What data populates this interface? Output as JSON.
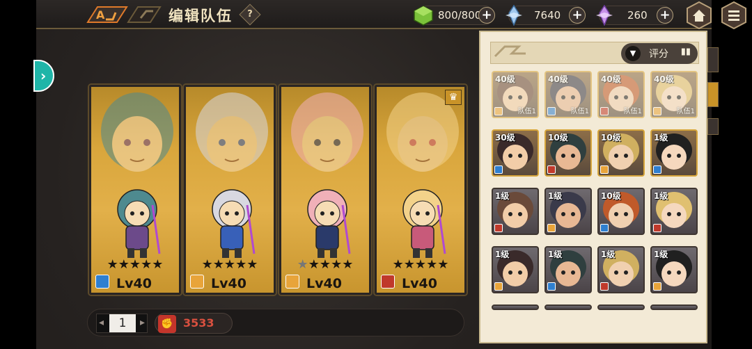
{
  "header": {
    "title": "编辑队伍",
    "help_label": "?"
  },
  "resources": [
    {
      "name": "stamina",
      "icon": "green-cube-icon",
      "value": "800/800",
      "color": "#7bc23a"
    },
    {
      "name": "crystal",
      "icon": "blue-crystal-icon",
      "value": "7640",
      "color": "#9fc7ee"
    },
    {
      "name": "gem",
      "icon": "purple-crystal-icon",
      "value": "260",
      "color": "#c690e8"
    }
  ],
  "team": {
    "page": "1",
    "power": "3533",
    "members": [
      {
        "name": "hero-1",
        "stars": 5,
        "level": "Lv40",
        "class_color": "#2f7fd0",
        "hair": "#4e8a8f",
        "accent": "#6c4a8a"
      },
      {
        "name": "hero-2",
        "stars": 5,
        "level": "Lv40",
        "class_color": "#e8a43a",
        "hair": "#d8d8e0",
        "accent": "#3860b8"
      },
      {
        "name": "hero-3",
        "stars": 4,
        "level": "Lv40",
        "class_color": "#e8a43a",
        "hair": "#f0b0b8",
        "accent": "#2a3a6a"
      },
      {
        "name": "hero-4",
        "stars": 5,
        "level": "Lv40",
        "class_color": "#c0392b",
        "hair": "#f3d28a",
        "accent": "#c85a7a",
        "crown": true
      }
    ]
  },
  "roster": {
    "sort_label": "评分",
    "heroes": [
      {
        "level": "40级",
        "team": "队伍1",
        "type": "gold",
        "dim": true
      },
      {
        "level": "40级",
        "team": "队伍1",
        "type": "gold",
        "dim": true
      },
      {
        "level": "40级",
        "team": "队伍1",
        "type": "gold",
        "dim": true
      },
      {
        "level": "40级",
        "team": "队伍1",
        "type": "gold",
        "dim": true
      },
      {
        "level": "30级",
        "team": "",
        "type": "gold"
      },
      {
        "level": "10级",
        "team": "",
        "type": "gold"
      },
      {
        "level": "10级",
        "team": "",
        "type": "gold"
      },
      {
        "level": "1级",
        "team": "",
        "type": "gold"
      },
      {
        "level": "1级",
        "team": "",
        "type": "purple"
      },
      {
        "level": "1级",
        "team": "",
        "type": "purple"
      },
      {
        "level": "10级",
        "team": "",
        "type": "purple"
      },
      {
        "level": "1级",
        "team": "",
        "type": "purple"
      },
      {
        "level": "1级",
        "team": "",
        "type": "purple"
      },
      {
        "level": "1级",
        "team": "",
        "type": "purple"
      },
      {
        "level": "1级",
        "team": "",
        "type": "purple"
      },
      {
        "level": "1级",
        "team": "",
        "type": "purple"
      }
    ]
  }
}
